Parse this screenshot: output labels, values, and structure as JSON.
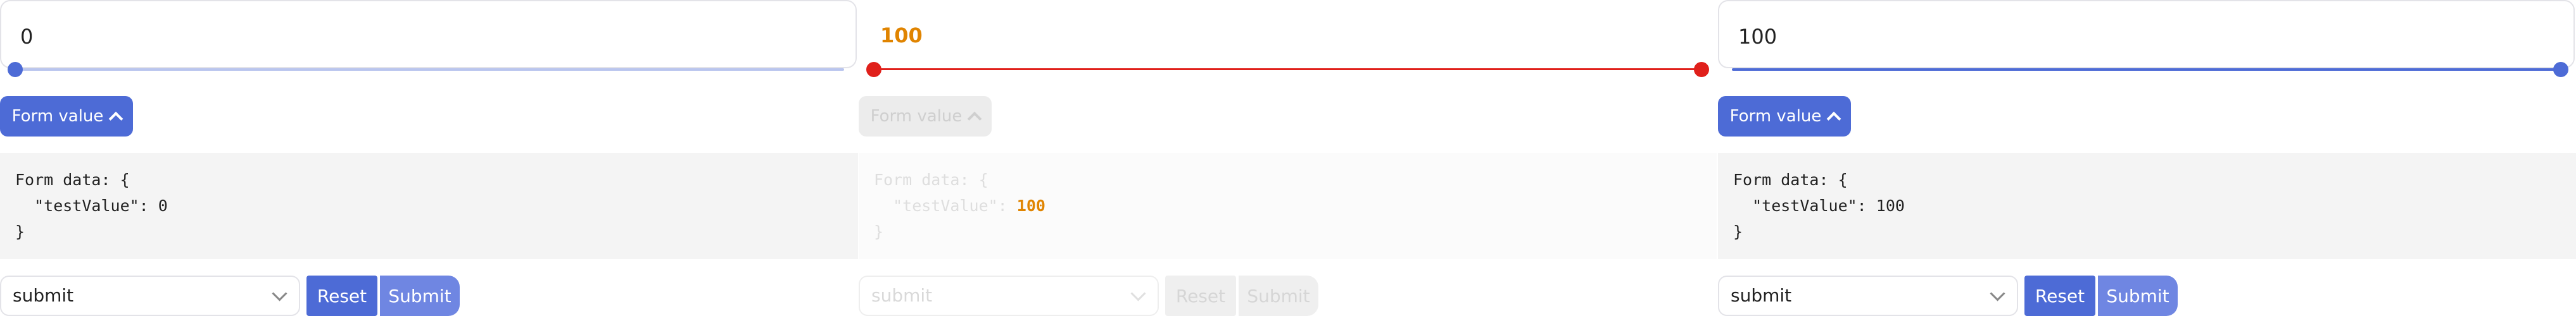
{
  "panels": [
    {
      "input_value": "0",
      "form_value_label": "Form value",
      "code_line1": "Form data: {",
      "code_key": "  \"testValue\": ",
      "code_value": "0",
      "code_line3": "}",
      "select_value": "submit",
      "reset_label": "Reset",
      "submit_label": "Submit",
      "slider_value": 0
    },
    {
      "input_value": "100",
      "form_value_label": "Form value",
      "code_line1": "Form data: {",
      "code_key": "  \"testValue\": ",
      "code_value": "100",
      "code_line3": "}",
      "select_value": "submit",
      "reset_label": "Reset",
      "submit_label": "Submit",
      "slider_range": [
        0,
        100
      ],
      "state": "disabled-error"
    },
    {
      "input_value": "100",
      "form_value_label": "Form value",
      "code_line1": "Form data: {",
      "code_key": "  \"testValue\": ",
      "code_value": "100",
      "code_line3": "}",
      "select_value": "submit",
      "reset_label": "Reset",
      "submit_label": "Submit",
      "slider_value": 100
    }
  ],
  "colors": {
    "accent": "#4d6bd6",
    "accent_soft": "#6f86e2",
    "error": "#e0201b",
    "warning_text": "#e08400"
  },
  "icons": {
    "form_value_toggle": "chevron-up-icon",
    "select_caret": "chevron-down-icon"
  }
}
